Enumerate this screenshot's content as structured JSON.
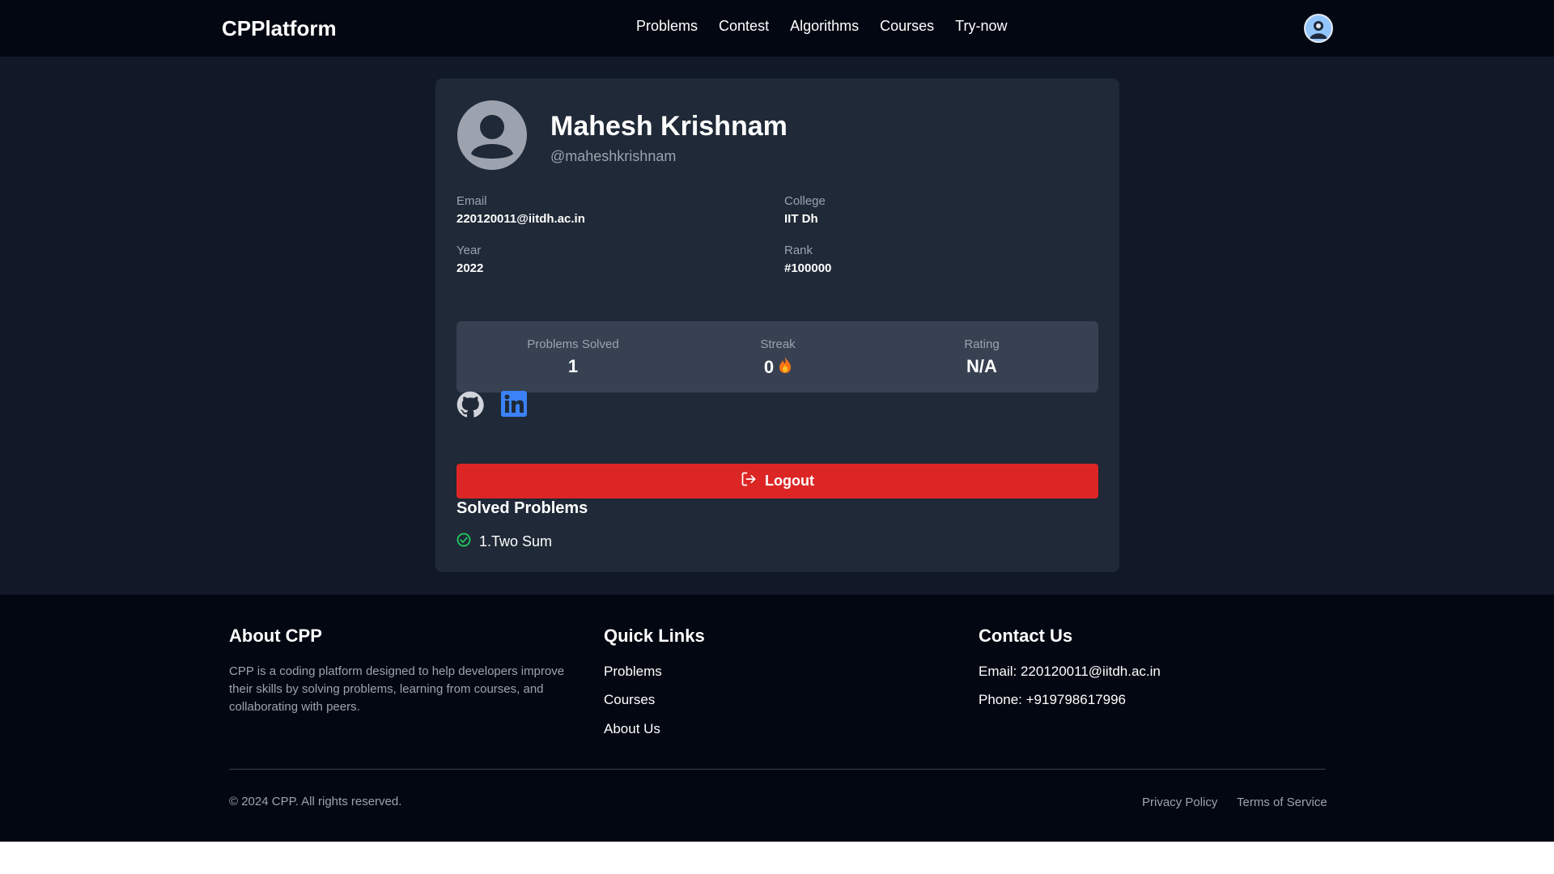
{
  "navbar": {
    "brand": "CPPlatform",
    "links": [
      "Problems",
      "Contest",
      "Algorithms",
      "Courses",
      "Try-now"
    ],
    "avatar_icon": "user-avatar-icon"
  },
  "profile": {
    "name": "Mahesh Krishnam",
    "username": "@maheshkrishnam",
    "avatar_icon": "user-placeholder-icon",
    "info": {
      "email_label": "Email",
      "email_value": "220120011@iitdh.ac.in",
      "college_label": "College",
      "college_value": "IIT Dh",
      "year_label": "Year",
      "year_value": "2022",
      "rank_label": "Rank",
      "rank_value": "#100000"
    },
    "stats": {
      "solved_label": "Problems Solved",
      "solved_value": "1",
      "streak_label": "Streak",
      "streak_value": "0",
      "rating_label": "Rating",
      "rating_value": "N/A"
    },
    "social_icons": [
      "github-icon",
      "linkedin-icon"
    ],
    "logout_label": "Logout",
    "solved_title": "Solved Problems",
    "solved_list": [
      "1.Two Sum"
    ]
  },
  "footer": {
    "about_title": "About CPP",
    "about_text": "CPP is a coding platform designed to help developers improve their skills by solving problems, learning from courses, and collaborating with peers.",
    "links_title": "Quick Links",
    "links": [
      "Problems",
      "Courses",
      "About Us"
    ],
    "contact_title": "Contact Us",
    "contact_email": "Email: 220120011@iitdh.ac.in",
    "contact_phone": "Phone: +919798617996",
    "copyright": "© 2024 CPP. All rights reserved.",
    "privacy": "Privacy Policy",
    "terms": "Terms of Service"
  },
  "colors": {
    "nav_bg": "#030712",
    "main_bg": "#111827",
    "card_bg": "#1f2937",
    "stats_bg": "#374151",
    "logout_red": "#dc2626",
    "success_green": "#22c55e",
    "linkedin_blue": "#3b82f6"
  }
}
